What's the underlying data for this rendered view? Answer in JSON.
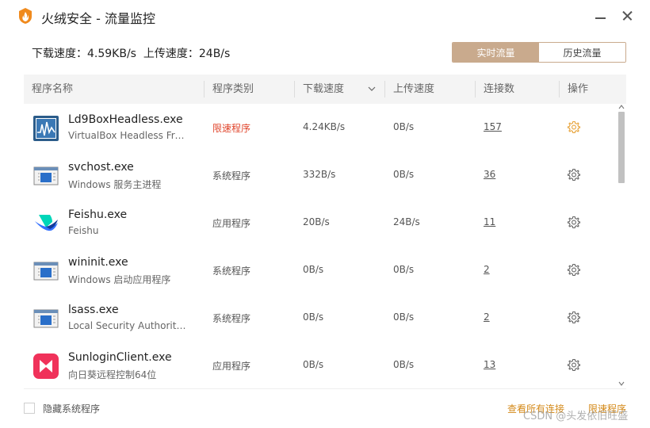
{
  "window": {
    "title": "火绒安全 - 流量监控"
  },
  "summary": {
    "download_label": "下载速度：",
    "download_value": "4.59KB/s",
    "upload_label": "上传速度：",
    "upload_value": "24B/s"
  },
  "tabs": {
    "realtime": "实时流量",
    "history": "历史流量",
    "active": "realtime"
  },
  "columns": {
    "name": "程序名称",
    "type": "程序类别",
    "download": "下载速度",
    "upload": "上传速度",
    "connections": "连接数",
    "action": "操作"
  },
  "rows": [
    {
      "name": "Ld9BoxHeadless.exe",
      "desc": "VirtualBox Headless Fro...",
      "type": "限速程序",
      "limited": true,
      "down": "4.24KB/s",
      "up": "0B/s",
      "conn": "157",
      "icon": "virtualbox-icon",
      "gear_color": "#e7a33a"
    },
    {
      "name": "svchost.exe",
      "desc": "Windows 服务主进程",
      "type": "系统程序",
      "limited": false,
      "down": "332B/s",
      "up": "0B/s",
      "conn": "36",
      "icon": "system-window-icon",
      "gear_color": "#666666"
    },
    {
      "name": "Feishu.exe",
      "desc": "Feishu",
      "type": "应用程序",
      "limited": false,
      "down": "20B/s",
      "up": "24B/s",
      "conn": "11",
      "icon": "feishu-icon",
      "gear_color": "#666666"
    },
    {
      "name": "wininit.exe",
      "desc": "Windows 启动应用程序",
      "type": "系统程序",
      "limited": false,
      "down": "0B/s",
      "up": "0B/s",
      "conn": "2",
      "icon": "system-window-icon",
      "gear_color": "#666666"
    },
    {
      "name": "lsass.exe",
      "desc": "Local Security Authority ...",
      "type": "系统程序",
      "limited": false,
      "down": "0B/s",
      "up": "0B/s",
      "conn": "2",
      "icon": "system-window-icon",
      "gear_color": "#666666"
    },
    {
      "name": "SunloginClient.exe",
      "desc": "向日葵远程控制64位",
      "type": "应用程序",
      "limited": false,
      "down": "0B/s",
      "up": "0B/s",
      "conn": "13",
      "icon": "sunlogin-icon",
      "gear_color": "#666666"
    }
  ],
  "footer": {
    "hide_system": "隐藏系统程序",
    "view_all": "查看所有连接",
    "limit": "限速程序"
  },
  "watermark": "CSDN @头发依旧旺盛",
  "colors": {
    "accent": "#c9aa8d",
    "link": "#d48a1a",
    "limited": "#e0452c"
  }
}
